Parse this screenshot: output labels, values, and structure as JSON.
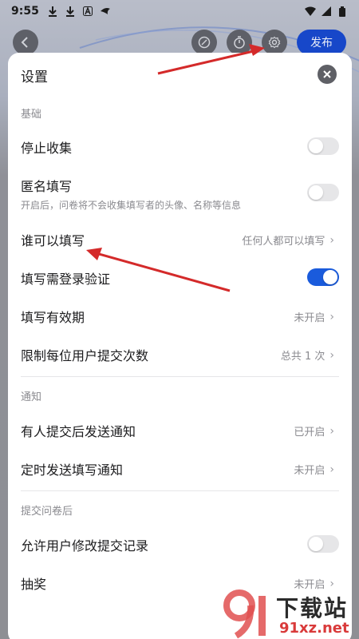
{
  "status_bar": {
    "time": "9:55",
    "icons": [
      "download-icon",
      "download-icon",
      "a-icon",
      "bird-icon"
    ],
    "right_icons": [
      "wifi-icon",
      "signal-icon",
      "battery-icon"
    ]
  },
  "topbar": {
    "back_icon": "back-icon",
    "icons": [
      "palette-icon",
      "timer-icon",
      "settings-icon"
    ],
    "publish_label": "发布"
  },
  "dialog": {
    "title": "设置",
    "sections": [
      {
        "label": "基础",
        "rows": [
          {
            "label": "停止收集",
            "type": "toggle",
            "on": false
          },
          {
            "label": "匿名填写",
            "sub": "开启后，问卷将不会收集填写者的头像、名称等信息",
            "type": "toggle",
            "on": false
          },
          {
            "label": "谁可以填写",
            "type": "link",
            "value": "任何人都可以填写"
          },
          {
            "label": "填写需登录验证",
            "type": "toggle",
            "on": true
          },
          {
            "label": "填写有效期",
            "type": "link",
            "value": "未开启"
          },
          {
            "label": "限制每位用户提交次数",
            "type": "link",
            "value": "总共 1 次"
          }
        ]
      },
      {
        "label": "通知",
        "rows": [
          {
            "label": "有人提交后发送通知",
            "type": "link",
            "value": "已开启"
          },
          {
            "label": "定时发送填写通知",
            "type": "link",
            "value": "未开启"
          }
        ]
      },
      {
        "label": "提交问卷后",
        "rows": [
          {
            "label": "允许用户修改提交记录",
            "type": "toggle",
            "on": false
          },
          {
            "label": "抽奖",
            "type": "link",
            "value": "未开启"
          }
        ]
      }
    ]
  },
  "watermark": {
    "title": "下载站",
    "domain": "91xz.net"
  },
  "colors": {
    "accent": "#1a5bdc",
    "publish": "#1747c9",
    "annotation": "#d42a2a"
  }
}
